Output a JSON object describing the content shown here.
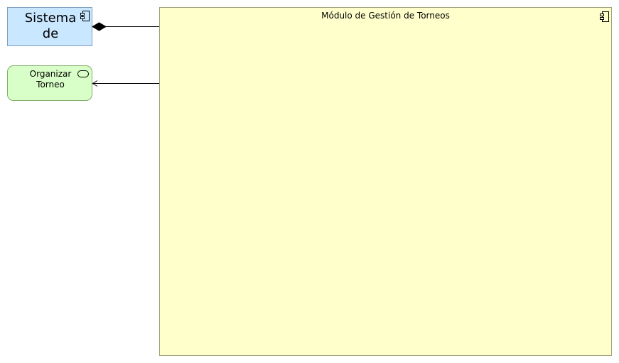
{
  "diagram": {
    "nodes": {
      "sistema": {
        "label": "Sistema de",
        "icon": "component-icon",
        "fill": "#c9e7ff"
      },
      "organizar": {
        "label": "Organizar Torneo",
        "icon": "service-icon",
        "fill": "#d8ffc7"
      },
      "modulo": {
        "label": "Módulo de Gestión de Torneos",
        "icon": "component-icon",
        "fill": "#ffffcc"
      }
    },
    "edges": [
      {
        "from": "modulo",
        "to": "sistema",
        "type": "composition"
      },
      {
        "from": "modulo",
        "to": "organizar",
        "type": "serving"
      }
    ]
  }
}
